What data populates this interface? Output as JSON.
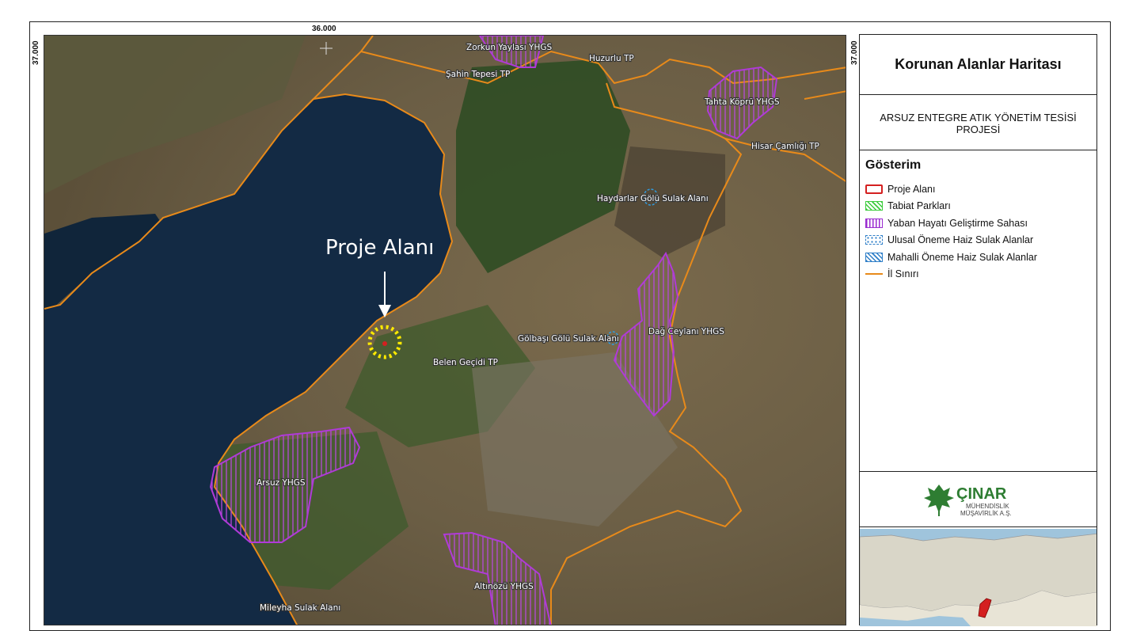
{
  "coords": {
    "top": "36.000",
    "left": "37.000",
    "right": "37.000"
  },
  "map": {
    "project_label": "Proje Alanı",
    "labels": {
      "zorkun": "Zorkun Yaylası YHGS",
      "huzurlu": "Huzurlu TP",
      "sahin": "Şahin Tepesi TP",
      "tahta": "Tahta Köprü YHGS",
      "hisar": "Hisar Çamlığı TP",
      "haydarlar": "Haydarlar Gölü Sulak Alanı",
      "golbasi": "Gölbaşı Gölü Sulak Alanı",
      "dag": "Dağ Ceylanı YHGS",
      "belen": "Belen Geçidi TP",
      "arsuz": "Arsuz YHGS",
      "altinozu": "Altınözü YHGS",
      "mileyha": "Mileyha Sulak Alanı"
    }
  },
  "panel": {
    "title": "Korunan Alanlar Haritası",
    "subtitle": "ARSUZ ENTEGRE ATIK YÖNETİM TESİSİ PROJESİ",
    "legend_title": "Gösterim",
    "legend": [
      {
        "label": "Proje Alanı",
        "icon": "red-outline-box",
        "color": "#d42020"
      },
      {
        "label": "Tabiat Parkları",
        "icon": "green-hatch-box",
        "color": "#3ccc3c"
      },
      {
        "label": "Yaban Hayatı Geliştirme Sahası",
        "icon": "purple-hatch-box",
        "color": "#9a2bd0"
      },
      {
        "label": "Ulusal Öneme Haiz Sulak Alanlar",
        "icon": "blue-dotted-box",
        "color": "#2f7fc8"
      },
      {
        "label": "Mahalli Öneme Haiz Sulak Alanlar",
        "icon": "blue-hatch-box",
        "color": "#2f7fc8"
      },
      {
        "label": "İl Sınırı",
        "icon": "orange-line",
        "color": "#e88a1a"
      }
    ],
    "logo": {
      "name": "ÇINAR",
      "line1": "MÜHENDİSLİK",
      "line2": "MÜŞAVİRLİK A.Ş."
    }
  }
}
